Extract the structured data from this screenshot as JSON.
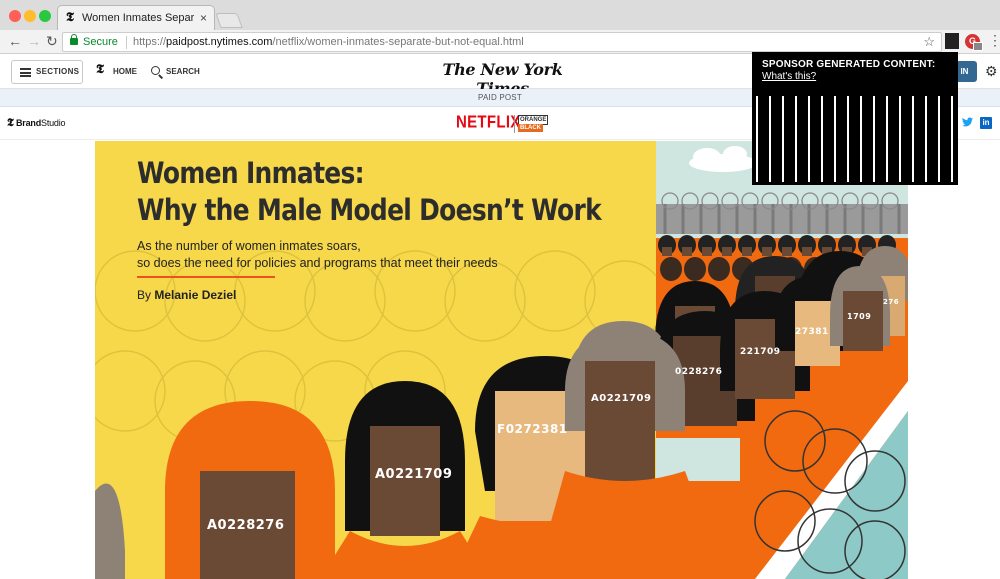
{
  "browser": {
    "tab_title": "Women Inmates Separate But E",
    "tab_close": "×",
    "secure_label": "Secure",
    "url_scheme": "https://",
    "url_host": "paidpost.nytimes.com",
    "url_path": "/netflix/women-inmates-separate-but-not-equal.html"
  },
  "nyt_header": {
    "sections_label": "SECTIONS",
    "home_label": "HOME",
    "search_label": "SEARCH",
    "masthead": "The New York Times",
    "login_label": "G IN"
  },
  "paid_post_label": "PAID POST",
  "brand_bar": {
    "brand_studio_bold": "Brand",
    "brand_studio_rest": "Studio",
    "netflix_logo": "NETFLIX",
    "oitnb_line1": "ORANGE",
    "oitnb_line2": "BLACK"
  },
  "sponsor_overlay": {
    "heading": "SPONSOR GENERATED CONTENT:",
    "link": "What's this?"
  },
  "hero": {
    "title_line1": "Women Inmates:",
    "title_line2": "Why the Male Model Doesn’t Work",
    "subtitle_line1": "As the number of women inmates soars,",
    "subtitle_line2": "so does the need for policies and programs that meet their needs",
    "byline_prefix": "By",
    "byline_author": "Melanie Deziel",
    "inmate_numbers": [
      "A0228276",
      "A0221709",
      "F0272381",
      "A0221709",
      "0228276",
      "221709",
      "27381",
      "1709",
      "276"
    ]
  },
  "colors": {
    "hero_yellow": "#f6d84a",
    "inmate_orange": "#f26a10",
    "accent_rule": "#e8541c",
    "secure_green": "#0a8a2a",
    "netflix_red": "#e50914",
    "login_blue": "#326891"
  },
  "icons": [
    "menu-icon",
    "nyt-t-icon",
    "search-icon",
    "gear-icon",
    "twitter-icon",
    "linkedin-icon",
    "star-icon",
    "lock-icon"
  ]
}
